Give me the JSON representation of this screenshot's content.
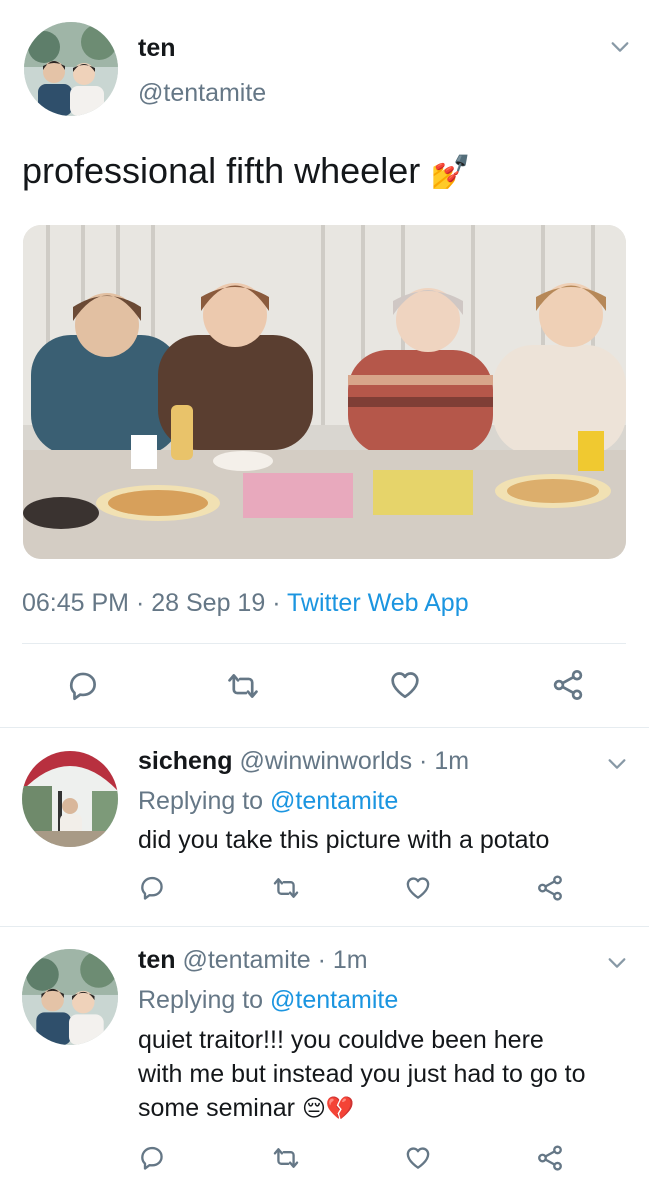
{
  "main_tweet": {
    "display_name": "ten",
    "handle": "@tentamite",
    "text": "professional fifth wheeler",
    "emoji": "💅",
    "time": "06:45 PM",
    "date": "28 Sep 19",
    "source": "Twitter Web App",
    "separator": "·"
  },
  "replies": [
    {
      "display_name": "sicheng",
      "handle": "@winwinworlds",
      "age": "1m",
      "replying_label": "Replying to",
      "replying_to": "@tentamite",
      "text": "did you take this picture with a potato"
    },
    {
      "display_name": "ten",
      "handle": "@tentamite",
      "age": "1m",
      "replying_label": "Replying to",
      "replying_to": "@tentamite",
      "text_lines": [
        "quiet traitor!!! you couldve been here",
        "with me but instead you just had to go to",
        "some seminar"
      ],
      "emoji": "😔💔"
    }
  ],
  "colors": {
    "link": "#1b95e0",
    "muted": "#657786",
    "text": "#14171a",
    "divider": "#e6ecf0"
  },
  "icons": [
    "chevron-down-icon",
    "reply-icon",
    "retweet-icon",
    "like-icon",
    "share-icon"
  ]
}
